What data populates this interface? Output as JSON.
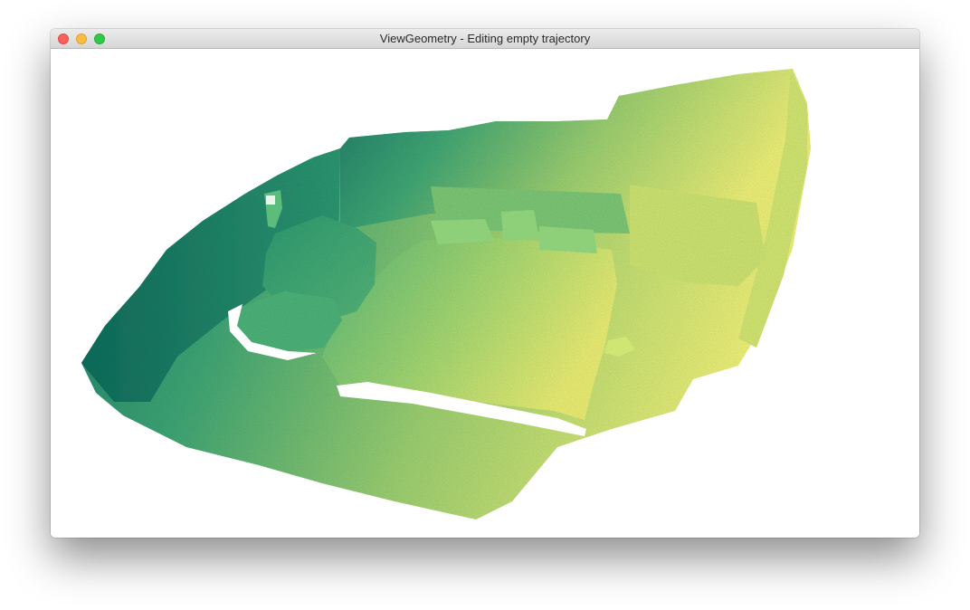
{
  "window": {
    "title": "ViewGeometry - Editing empty trajectory"
  },
  "viewport": {
    "content": "3d-point-cloud-bedroom",
    "colormap": [
      "#1f7a6a",
      "#3fa878",
      "#9fd373",
      "#f2f57a"
    ],
    "background": "#ffffff"
  },
  "icons": {
    "close": "close-icon",
    "minimize": "minimize-icon",
    "zoom": "zoom-icon"
  }
}
